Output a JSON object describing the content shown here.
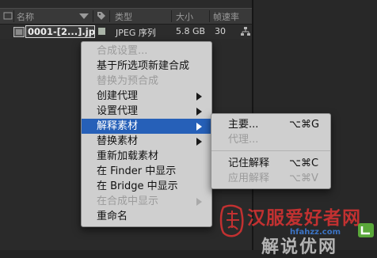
{
  "project_panel": {
    "columns": {
      "name": "名称",
      "type": "类型",
      "size": "大小",
      "fps": "帧速率"
    },
    "row": {
      "name": "0001-[2...].jpg",
      "type": "JPEG 序列",
      "size": "5.8 GB",
      "fps": "30",
      "label_color": "#aab4a8"
    }
  },
  "context_menu": {
    "items": [
      {
        "label": "合成设置...",
        "state": "disabled"
      },
      {
        "label": "基于所选项新建合成",
        "state": "enabled"
      },
      {
        "label": "替换为预合成",
        "state": "disabled"
      },
      {
        "label": "创建代理",
        "state": "enabled",
        "submenu": true
      },
      {
        "label": "设置代理",
        "state": "enabled",
        "submenu": true
      },
      {
        "label": "解释素材",
        "state": "selected",
        "submenu": true
      },
      {
        "label": "替换素材",
        "state": "enabled",
        "submenu": true
      },
      {
        "label": "重新加载素材",
        "state": "enabled"
      },
      {
        "label": "在 Finder 中显示",
        "state": "enabled"
      },
      {
        "label": "在 Bridge 中显示",
        "state": "enabled"
      },
      {
        "label": "在合成中显示",
        "state": "disabled",
        "submenu": true
      },
      {
        "label": "重命名",
        "state": "enabled"
      }
    ],
    "selected_color": "#2660b8"
  },
  "submenu": {
    "items": [
      {
        "label": "主要...",
        "shortcut": "⌥⌘G",
        "state": "enabled"
      },
      {
        "label": "代理...",
        "shortcut": "",
        "state": "disabled"
      },
      {
        "label": "记住解释",
        "shortcut": "⌥⌘C",
        "state": "enabled"
      },
      {
        "label": "应用解释",
        "shortcut": "⌥⌘V",
        "state": "disabled"
      }
    ]
  },
  "watermark": {
    "title": "汉服爱好者网",
    "url": "hfahzz.com",
    "ghost_text": "解说优网"
  }
}
